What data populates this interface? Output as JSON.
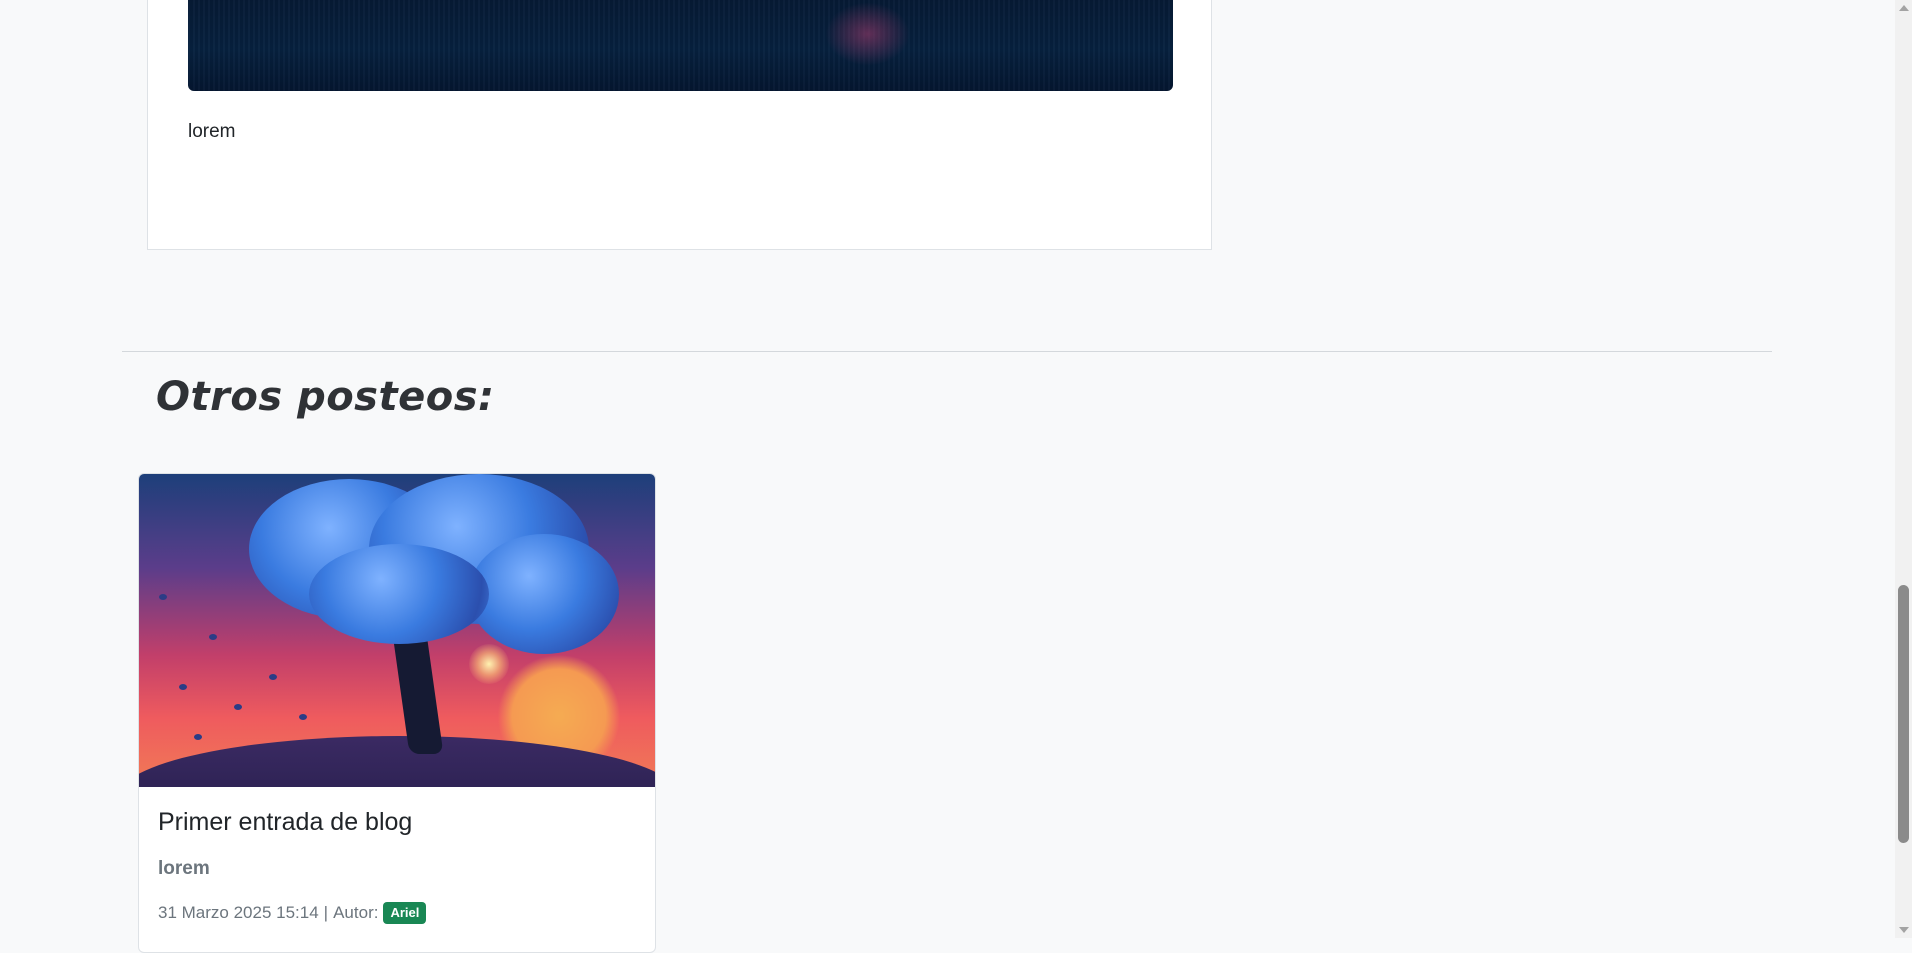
{
  "post": {
    "text": "lorem",
    "image": "night-water-image"
  },
  "section": {
    "title": "Otros posteos:"
  },
  "posts": [
    {
      "title": "Primer entrada de blog",
      "subtitle": "lorem",
      "date": "31 Marzo 2025 15:14",
      "separator": "|",
      "author_label": "Autor:",
      "author": "Ariel",
      "image": "blue-tree-sunset-image"
    }
  ],
  "colors": {
    "background": "#f8f9fa",
    "badge": "#198754",
    "muted": "#6c757d"
  },
  "icons": {
    "scroll_up": "triangle-up",
    "scroll_down": "triangle-down"
  }
}
